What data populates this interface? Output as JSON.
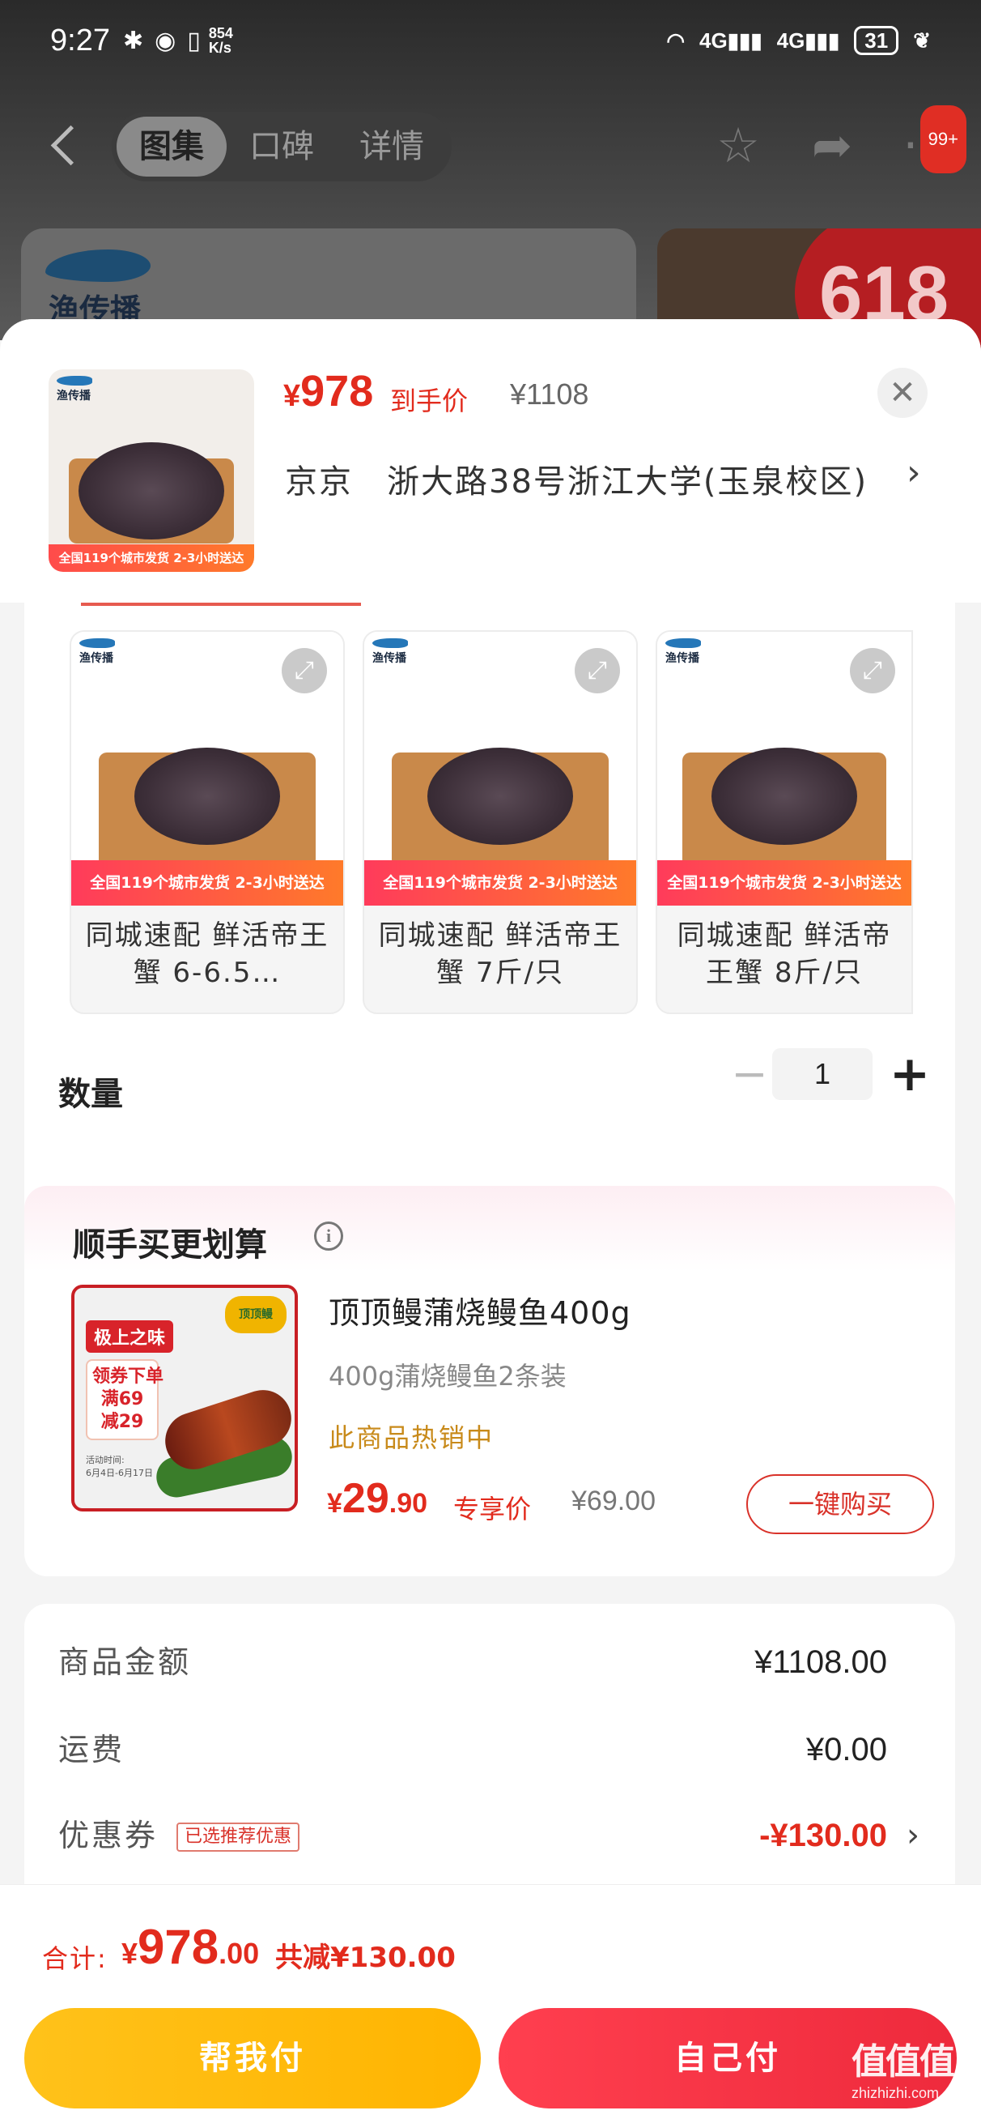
{
  "status_bar": {
    "time": "9:27",
    "speed": "854\nK/s",
    "signal1": "4G",
    "signal2": "4G",
    "battery": "31"
  },
  "nav": {
    "tabs": [
      {
        "label": "图集",
        "active": true
      },
      {
        "label": "口碑",
        "active": false
      },
      {
        "label": "详情",
        "active": false
      }
    ],
    "more_badge": "99+"
  },
  "background": {
    "brand_name": "渔传播",
    "promo_text": "618"
  },
  "product": {
    "price": "978",
    "price_tag": "到手价",
    "original_price": "¥1108",
    "address": "京京　浙大路38号浙江大学(玉泉校区)",
    "thumb_strip": "全国119个城市发货 2-3小时送达",
    "thumb_brand": "渔传播"
  },
  "variants": [
    {
      "title": "同城速配 鲜活帝王蟹 6-6.5…",
      "strip": "全国119个城市发货 2-3小时送达",
      "brand": "渔传播"
    },
    {
      "title": "同城速配 鲜活帝王蟹 7斤/只",
      "strip": "全国119个城市发货 2-3小时送达",
      "brand": "渔传播"
    },
    {
      "title": "同城速配 鲜活帝王蟹 8斤/只",
      "strip": "全国119个城市发货 2-3小时送达",
      "brand": "渔传播"
    }
  ],
  "quantity": {
    "label": "数量",
    "value": "1"
  },
  "upsell": {
    "title": "顺手买更划算",
    "name": "顶顶鳗蒲烧鳗鱼400g",
    "desc": "400g蒲烧鳗鱼2条装",
    "hot": "此商品热销中",
    "price_int": "29",
    "price_dec": ".90",
    "price_tag": "专享价",
    "original_price": "¥69.00",
    "buy_label": "一键购买",
    "img_badge": "极上之味",
    "img_deal": "领券下单\n满69\n减29",
    "img_date": "活动时间:\n6月4日-6月17日",
    "img_logo": "顶顶鳗"
  },
  "summary": {
    "rows": [
      {
        "label": "商品金额",
        "value": "¥1108.00"
      },
      {
        "label": "运费",
        "value": "¥0.00"
      },
      {
        "label": "优惠券",
        "tag": "已选推荐优惠",
        "value": "-¥130.00"
      }
    ]
  },
  "footer": {
    "total_label": "合计:",
    "total_int": "978",
    "total_dec": ".00",
    "saving": "共减¥130.00",
    "help_pay": "帮我付",
    "self_pay": "自己付"
  },
  "watermark": {
    "main": "值值值",
    "sub": "zhizhizhi.com"
  },
  "colors": {
    "accent_red": "#e22b1d",
    "help_button": "#ffb400",
    "self_button": "#ee2a3c"
  }
}
